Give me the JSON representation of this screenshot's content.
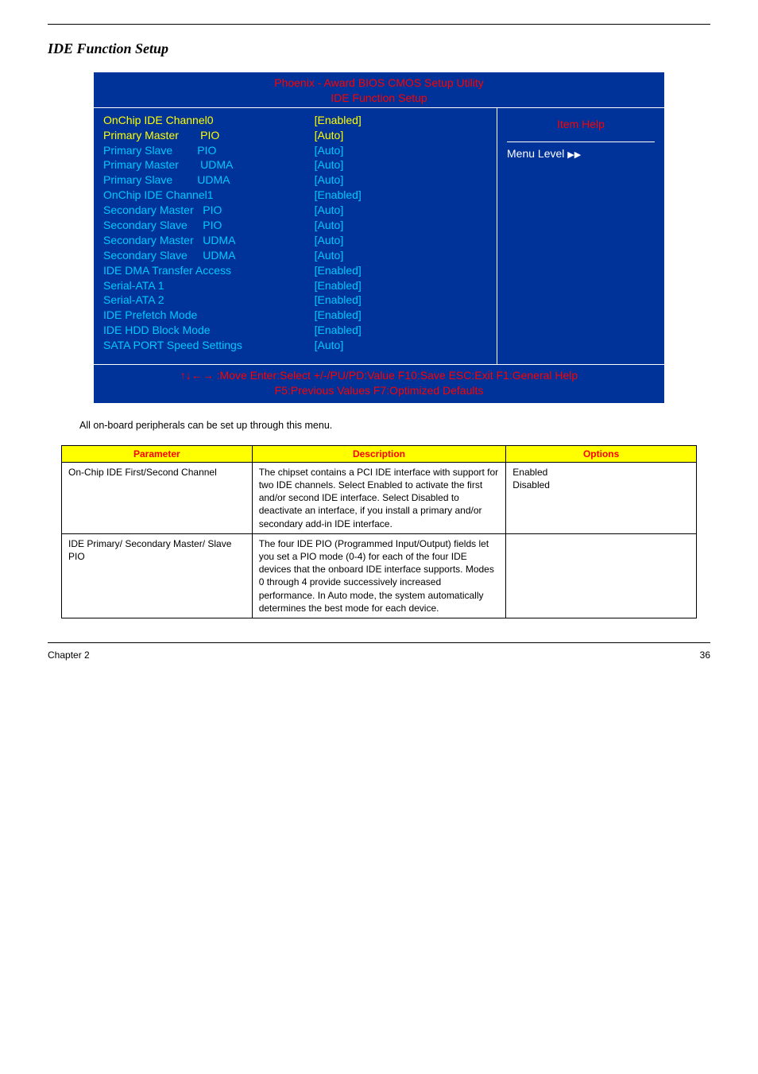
{
  "page": {
    "title": "IDE Function Setup",
    "caption": "All on-board peripherals can be set up through this menu.",
    "footer_left": "Chapter 2",
    "footer_right": "36"
  },
  "bios": {
    "header1": "Phoenix - Award BIOS CMOS Setup Utility",
    "header2": "IDE Function Setup",
    "itemHelp": "Item Help",
    "menuLevel": "Menu Level",
    "rows": [
      {
        "label": "OnChip IDE Channel0",
        "value": "[Enabled]",
        "yellow": true
      },
      {
        "label": "Primary Master       PIO",
        "value": "[Auto]",
        "yellow": true
      },
      {
        "label": "Primary Slave        PIO",
        "value": "[Auto]"
      },
      {
        "label": "Primary Master       UDMA",
        "value": "[Auto]"
      },
      {
        "label": "Primary Slave        UDMA",
        "value": "[Auto]"
      },
      {
        "label": "OnChip IDE Channel1",
        "value": "[Enabled]"
      },
      {
        "label": "Secondary Master   PIO",
        "value": "[Auto]"
      },
      {
        "label": "Secondary Slave     PIO",
        "value": "[Auto]"
      },
      {
        "label": "Secondary Master   UDMA",
        "value": "[Auto]"
      },
      {
        "label": "Secondary Slave     UDMA",
        "value": "[Auto]"
      },
      {
        "label": "IDE DMA Transfer Access",
        "value": "[Enabled]"
      },
      {
        "label": "Serial-ATA 1",
        "value": "[Enabled]"
      },
      {
        "label": "Serial-ATA 2",
        "value": "[Enabled]"
      },
      {
        "label": "IDE Prefetch Mode",
        "value": "[Enabled]"
      },
      {
        "label": "IDE HDD Block Mode",
        "value": "[Enabled]"
      },
      {
        "label": "SATA PORT Speed Settings",
        "value": "[Auto]"
      }
    ],
    "footer1": "↑↓←→ :Move  Enter:Select   +/-/PU/PD:Value  F10:Save  ESC:Exit  F1:General Help",
    "footer2": "F5:Previous Values  F7:Optimized Defaults"
  },
  "table": {
    "headers": {
      "param": "Parameter",
      "desc": "Description",
      "opt": "Options"
    },
    "rows": [
      {
        "param": "On-Chip IDE First/Second Channel",
        "desc": "The chipset contains a PCI IDE interface with support for two IDE channels. Select Enabled to activate the first and/or second IDE interface. Select Disabled to deactivate an interface, if you install a primary and/or secondary add-in IDE interface.",
        "opt": "Enabled\nDisabled"
      },
      {
        "param": "IDE Primary/ Secondary Master/ Slave PIO",
        "desc": "The four IDE PIO (Programmed Input/Output) fields let you set a PIO mode (0-4) for each of the four IDE devices that the onboard IDE interface supports. Modes 0 through 4 provide successively increased performance. In Auto mode, the system automatically determines the best mode for each device.",
        "opt": ""
      }
    ]
  }
}
